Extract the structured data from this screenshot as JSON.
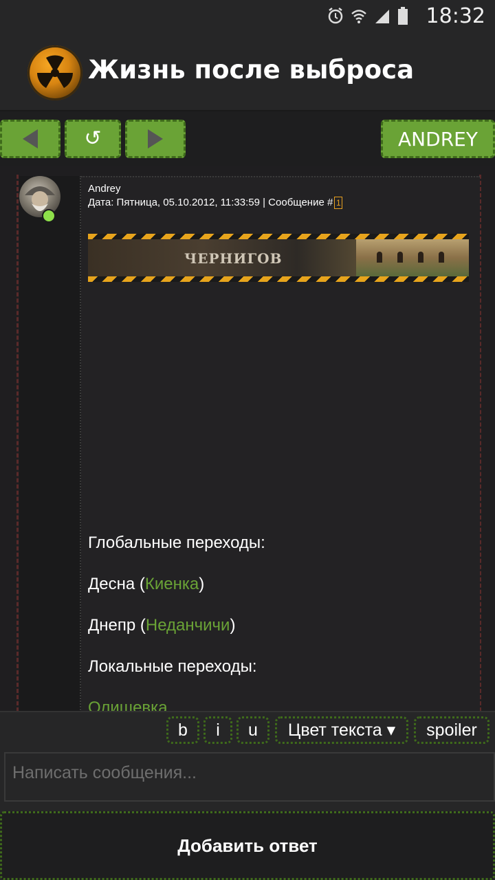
{
  "status_bar": {
    "time": "18:32",
    "icons": [
      "alarm-icon",
      "wifi-icon",
      "signal-icon",
      "battery-icon"
    ]
  },
  "header": {
    "title": "Жизнь после выброса",
    "logo_icon": "radiation-icon"
  },
  "toolbar": {
    "back_icon": "arrow-left-icon",
    "refresh_glyph": "↺",
    "forward_icon": "arrow-right-icon",
    "user_label": "ANDREY"
  },
  "post": {
    "author": "Andrey",
    "meta": "Дата: Пятница, 05.10.2012, 11:33:59 | Сообщение #",
    "message_number": "1",
    "banner_text": "ЧЕРНИГОВ",
    "lines": [
      {
        "text": "Глобальные переходы:"
      },
      {
        "prefix": "Десна (",
        "link": "Киенка",
        "suffix": ")"
      },
      {
        "prefix": "Днепр (",
        "link": "Неданчичи",
        "suffix": ")"
      },
      {
        "text": "Локальные переходы:"
      },
      {
        "link": "Олишевка"
      }
    ]
  },
  "format_bar": {
    "bold": "b",
    "italic": "i",
    "underline": "u",
    "color": "Цвет текста ▾",
    "spoiler": "spoiler"
  },
  "composer": {
    "placeholder": "Написать сообщения...",
    "value": ""
  },
  "submit_label": "Добавить ответ",
  "colors": {
    "accent": "#6aa336",
    "background": "#262627",
    "online": "#8ee04a"
  }
}
